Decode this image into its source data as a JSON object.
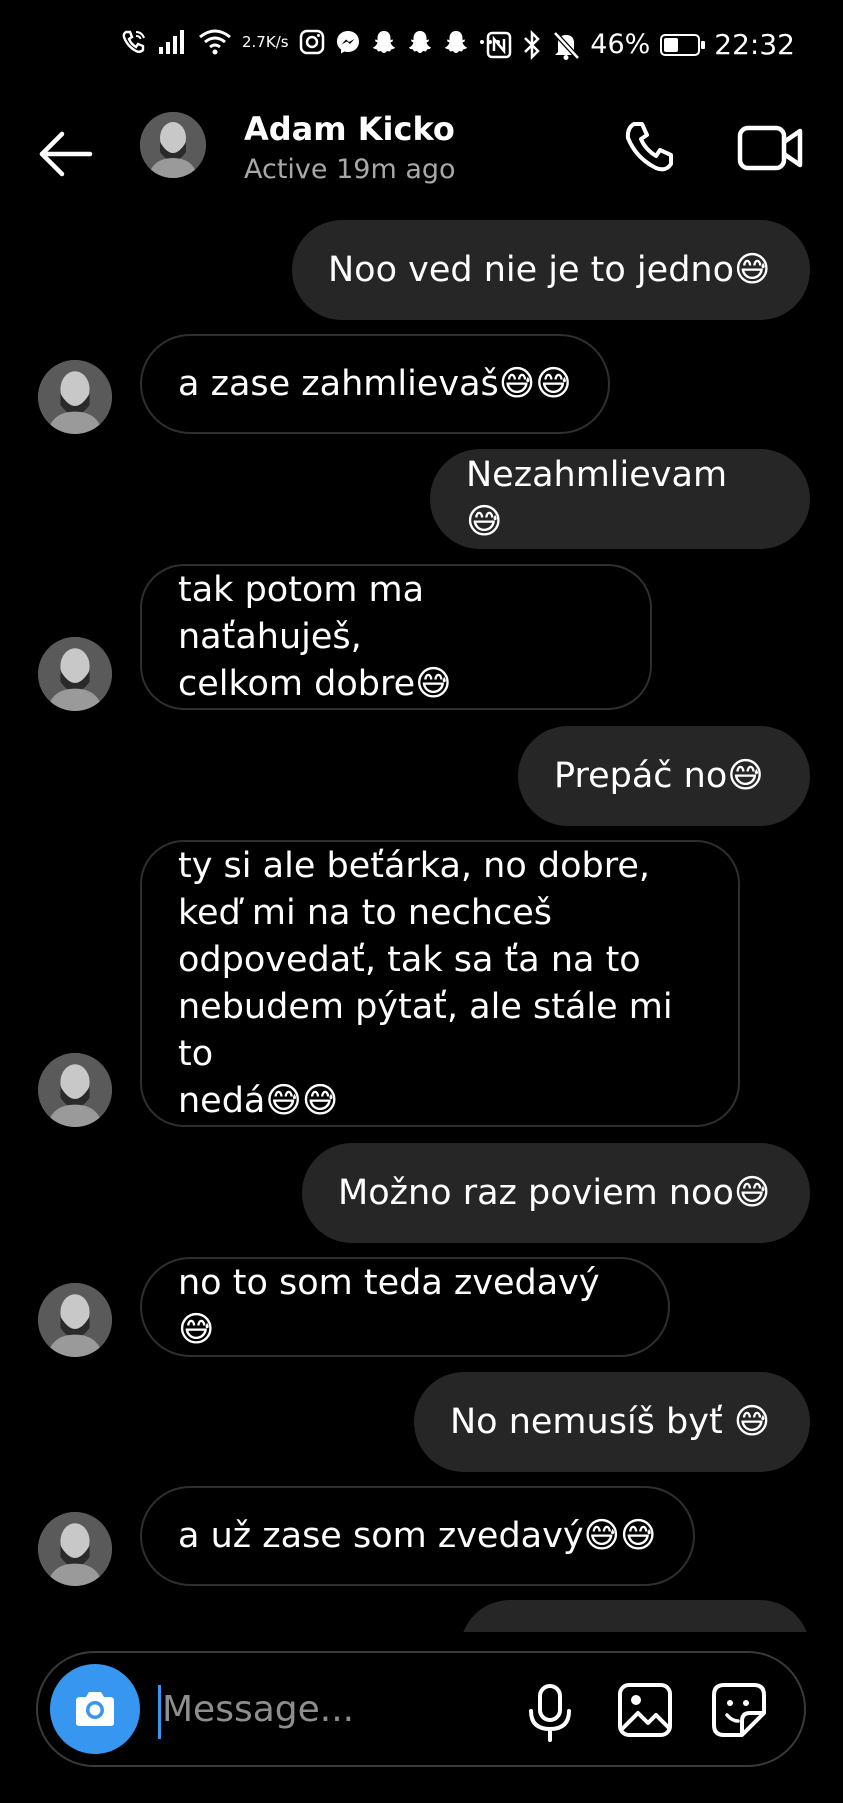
{
  "status_bar": {
    "net_speed_value": "2.7",
    "net_speed_unit": "K/s",
    "battery": "46%",
    "battery_level": 0.46,
    "time": "22:32",
    "left_icons": [
      "wifi-call-icon",
      "signal-icon",
      "wifi-icon",
      "instagram-icon",
      "messenger-icon",
      "snapchat-icon",
      "snapchat-icon",
      "snapchat-icon",
      "more-dots-icon"
    ],
    "right_icons": [
      "nfc-icon",
      "bluetooth-icon",
      "bell-off-icon",
      "battery-icon"
    ]
  },
  "header": {
    "name": "Adam Kicko",
    "status": "Active 19m ago"
  },
  "messages": [
    {
      "side": "sent",
      "text": "Noo ved nie je to jedno😅"
    },
    {
      "side": "received",
      "text": "a zase zahmlievaš😅😅"
    },
    {
      "side": "sent",
      "text": "Nezahmlievam 😅"
    },
    {
      "side": "received",
      "text": "tak potom ma naťahuješ,\ncelkom dobre😅"
    },
    {
      "side": "sent",
      "text": "Prepáč no😅"
    },
    {
      "side": "received",
      "text": "ty si ale beťárka, no dobre,\nkeď mi na to nechceš\nodpovedať, tak sa ťa na to\nnebudem pýtať, ale stále mi to\nnedá😅😅"
    },
    {
      "side": "sent",
      "text": "Možno raz poviem noo😅"
    },
    {
      "side": "received",
      "text": "no to som teda zvedavý😅"
    },
    {
      "side": "sent",
      "text": "No nemusíš byť 😅"
    },
    {
      "side": "received",
      "text": "a už zase som zvedavý😅😅"
    },
    {
      "side": "sent",
      "text": ""
    }
  ],
  "composer": {
    "placeholder": "Message..."
  },
  "colors": {
    "background": "#000000",
    "sent_bubble": "#262626",
    "received_border": "#2f2f2f",
    "accent": "#3797f0",
    "muted_text": "#a8a8a8"
  }
}
